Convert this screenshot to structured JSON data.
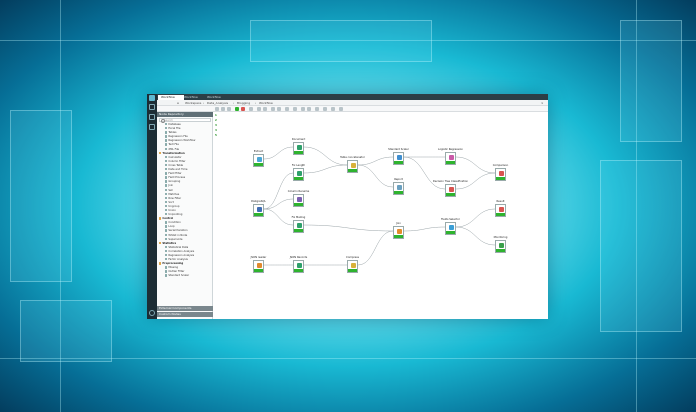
{
  "tabs": [
    {
      "label": "Workflow"
    },
    {
      "label": "Workflow"
    },
    {
      "label": "Workflow"
    }
  ],
  "breadcrumbs": [
    "Workspace",
    "Data_Analysis",
    "Blogging",
    "Workflow"
  ],
  "node_repository": {
    "header": "Node Repository",
    "search_placeholder": "Search",
    "items": [
      {
        "label": "Database",
        "level": "node"
      },
      {
        "label": "Excel File",
        "level": "node"
      },
      {
        "label": "Tables",
        "level": "node"
      },
      {
        "label": "Regression File",
        "level": "node"
      },
      {
        "label": "Regression Workflow",
        "level": "node"
      },
      {
        "label": "Text File",
        "level": "node"
      },
      {
        "label": "XML File",
        "level": "node"
      },
      {
        "label": "Transformation",
        "level": "cat"
      },
      {
        "label": "Calculator",
        "level": "node"
      },
      {
        "label": "Column Filter",
        "level": "node"
      },
      {
        "label": "Cross Table",
        "level": "node"
      },
      {
        "label": "Date and Time",
        "level": "node"
      },
      {
        "label": "Field Filter",
        "level": "node"
      },
      {
        "label": "Field Process",
        "level": "node"
      },
      {
        "label": "Grouping",
        "level": "node"
      },
      {
        "label": "Join",
        "level": "node"
      },
      {
        "label": "Set",
        "level": "node"
      },
      {
        "label": "Matches",
        "level": "node"
      },
      {
        "label": "Row Filter",
        "level": "node"
      },
      {
        "label": "Sort",
        "level": "node"
      },
      {
        "label": "Ungroup",
        "level": "node"
      },
      {
        "label": "Union",
        "level": "node"
      },
      {
        "label": "Unpivoting",
        "level": "node"
      },
      {
        "label": "Control",
        "level": "cat"
      },
      {
        "label": "Condition",
        "level": "node"
      },
      {
        "label": "Loop",
        "level": "node"
      },
      {
        "label": "Serial Iteration",
        "level": "node"
      },
      {
        "label": "Whilst in Node",
        "level": "node"
      },
      {
        "label": "Supernode",
        "level": "node"
      },
      {
        "label": "Statistics",
        "level": "cat"
      },
      {
        "label": "Statistical Data",
        "level": "node"
      },
      {
        "label": "Correlation Analysis",
        "level": "node"
      },
      {
        "label": "Regression Analysis",
        "level": "node"
      },
      {
        "label": "Factor Analysis",
        "level": "node"
      },
      {
        "label": "Preprocessing",
        "level": "cat"
      },
      {
        "label": "Missing",
        "level": "node"
      },
      {
        "label": "Outlier Filter",
        "level": "node"
      },
      {
        "label": "Standard Scaler",
        "level": "node"
      }
    ]
  },
  "panels": {
    "external_components": "External Components",
    "custom_nodes": "Custom Nodes"
  },
  "annotations": [
    "1",
    "2",
    "3",
    "4",
    "5"
  ],
  "workflow": {
    "nodes": [
      {
        "id": "n1",
        "label": "Extract",
        "color": "#4aa6d6"
      },
      {
        "id": "n2",
        "label": "PostgreSQL",
        "color": "#3f6db3"
      },
      {
        "id": "n3",
        "label": "JSON reader",
        "color": "#e08a2e"
      },
      {
        "id": "n4",
        "label": "Document",
        "color": "#2ea06b"
      },
      {
        "id": "n5",
        "label": "Fix Length",
        "color": "#2ea06b"
      },
      {
        "id": "n6",
        "label": "Column Rename",
        "color": "#7a5fb0"
      },
      {
        "id": "n7",
        "label": "Fix Mailing",
        "color": "#2ea06b"
      },
      {
        "id": "n8",
        "label": "JSON Records",
        "color": "#2ea06b"
      },
      {
        "id": "n9",
        "label": "Table concatenator",
        "color": "#d8b23a"
      },
      {
        "id": "n10",
        "label": "Compress",
        "color": "#d8b23a"
      },
      {
        "id": "n11",
        "label": "Standard Scaler",
        "color": "#3f8fd0"
      },
      {
        "id": "n12",
        "label": "Report",
        "color": "#6aa0c0"
      },
      {
        "id": "n13",
        "label": "Join",
        "color": "#e38b2a"
      },
      {
        "id": "n14",
        "label": "Logistic Regression",
        "color": "#c95aa8"
      },
      {
        "id": "n15",
        "label": "Decision Tree Classification",
        "color": "#d9534f"
      },
      {
        "id": "n16",
        "label": "Fields Selector",
        "color": "#3a9fd6"
      },
      {
        "id": "n17",
        "label": "Comparison",
        "color": "#d9534f"
      },
      {
        "id": "n18",
        "label": "Result",
        "color": "#d9534f"
      },
      {
        "id": "n19",
        "label": "Monitoring",
        "color": "#3aa04b"
      }
    ]
  },
  "colors": {
    "accent": "#2eb32e",
    "rail": "#1d2d35",
    "header": "#5f6f76"
  }
}
